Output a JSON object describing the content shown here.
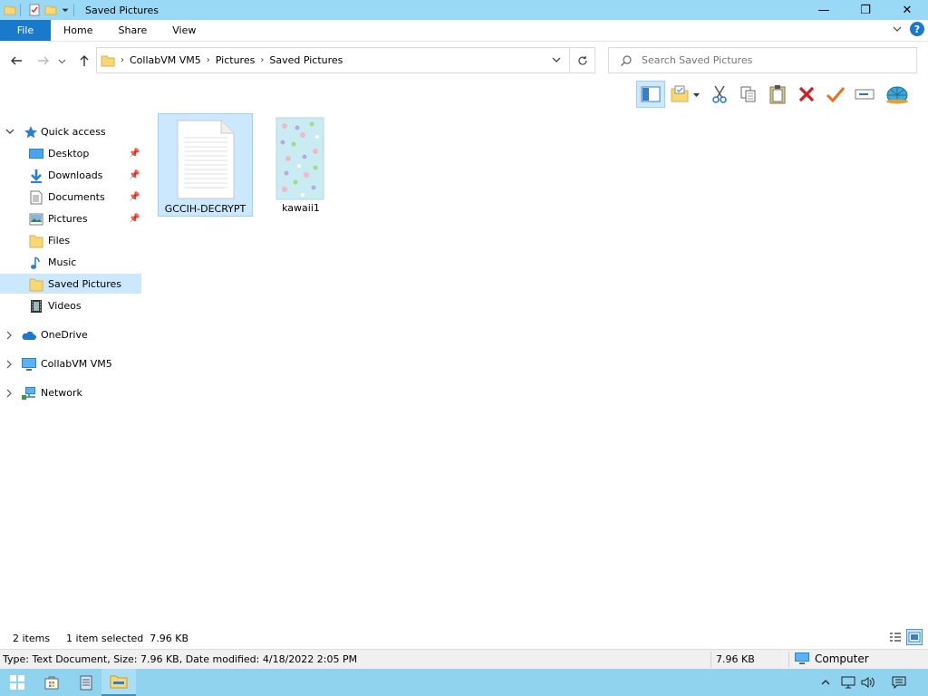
{
  "window": {
    "title": "Saved Pictures",
    "controls": {
      "minimize": "—",
      "maximize": "❐",
      "close": "✕"
    }
  },
  "ribbon": {
    "tabs": [
      "File",
      "Home",
      "Share",
      "View"
    ],
    "expand_icon": "chevron-down-icon",
    "help_label": "?"
  },
  "address": {
    "crumbs": [
      "CollabVM VM5",
      "Pictures",
      "Saved Pictures"
    ]
  },
  "search": {
    "placeholder": "Search Saved Pictures"
  },
  "toolbar": {
    "icons": [
      "preview-pane-icon",
      "new-folder-icon",
      "cut-icon",
      "copy-icon",
      "paste-icon",
      "delete-icon",
      "check-icon",
      "rename-icon",
      "shell-icon"
    ]
  },
  "navpane": {
    "quick_access": "Quick access",
    "quick_items": [
      {
        "label": "Desktop",
        "pinned": true
      },
      {
        "label": "Downloads",
        "pinned": true
      },
      {
        "label": "Documents",
        "pinned": true
      },
      {
        "label": "Pictures",
        "pinned": true
      },
      {
        "label": "Files",
        "pinned": false
      },
      {
        "label": "Music",
        "pinned": false
      },
      {
        "label": "Saved Pictures",
        "pinned": false,
        "selected": true
      },
      {
        "label": "Videos",
        "pinned": false
      }
    ],
    "onedrive": "OneDrive",
    "thispc": "CollabVM VM5",
    "network": "Network"
  },
  "files": [
    {
      "name": "GCCIH-DECRYPT",
      "kind": "text-document",
      "selected": true
    },
    {
      "name": "kawaii1",
      "kind": "image",
      "selected": false
    }
  ],
  "status": {
    "count": "2 items",
    "selection": "1 item selected  7.96 KB"
  },
  "details": {
    "text": "Type: Text Document, Size: 7.96 KB, Date modified: 4/18/2022 2:05 PM",
    "size": "7.96 KB",
    "computer": "Computer"
  },
  "colors": {
    "titlebar": "#99d9f5",
    "accent": "#1979ca",
    "selection": "#cce8ff",
    "taskbar": "#8fd3ef"
  }
}
